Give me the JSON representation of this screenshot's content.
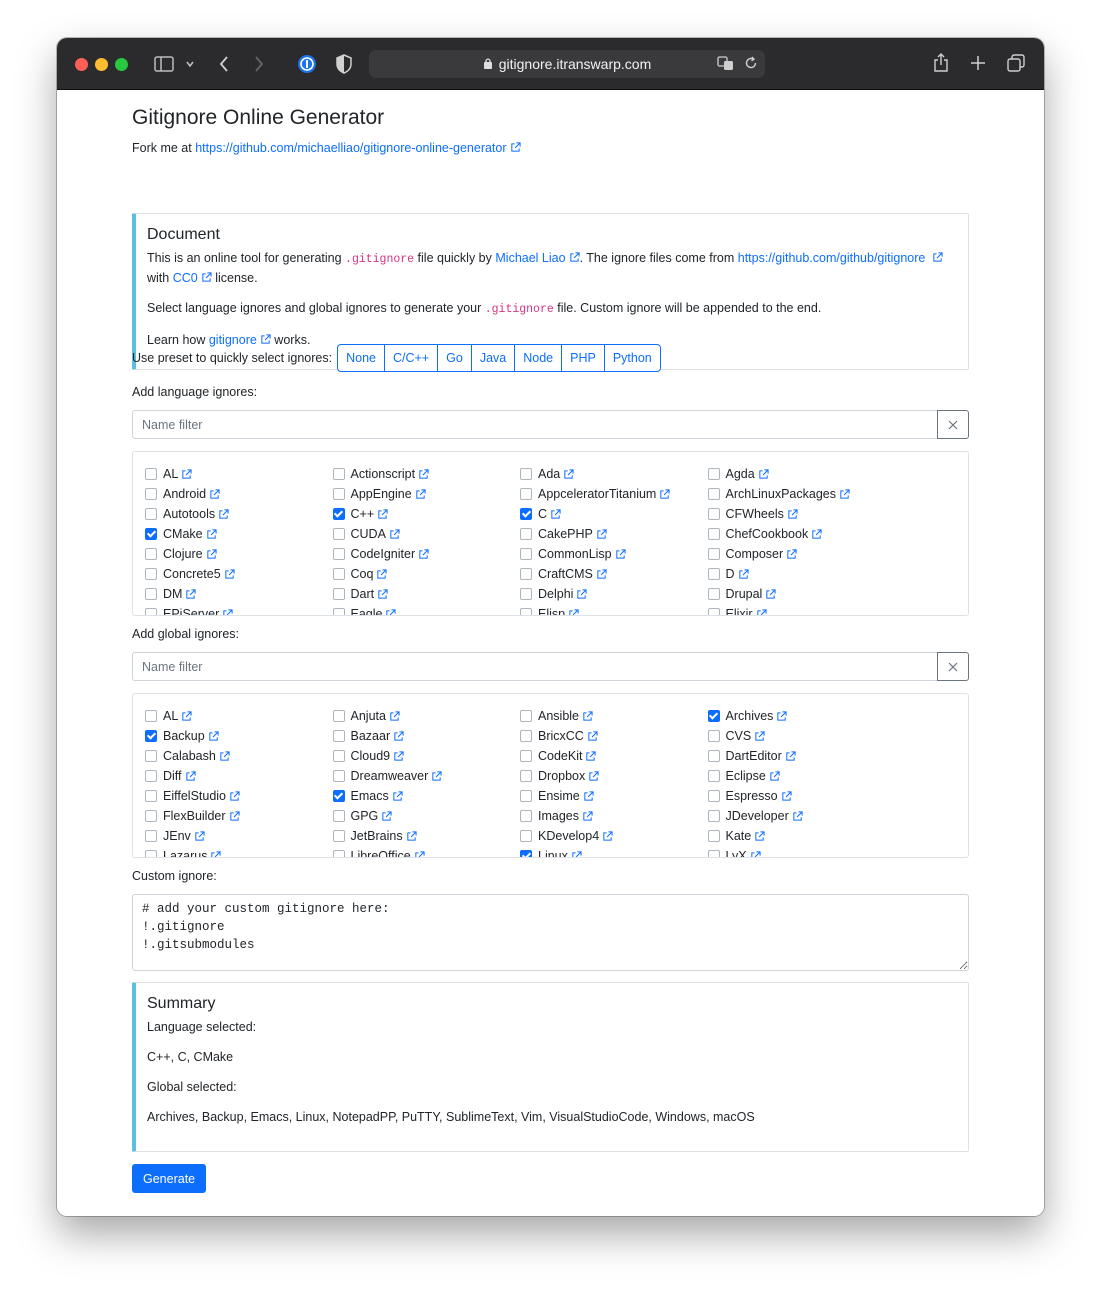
{
  "browser": {
    "url": "gitignore.itranswarp.com"
  },
  "page": {
    "title": "Gitignore Online Generator",
    "fork_prefix": "Fork me at",
    "fork_link": "https://github.com/michaelliao/gitignore-online-generator"
  },
  "document": {
    "heading": "Document",
    "p1_a": "This is an online tool for generating",
    "p1_code": ".gitignore",
    "p1_b": "file quickly by",
    "p1_author": "Michael Liao",
    "p1_c": ". The ignore files come from",
    "p1_source": "https://github.com/github/gitignore",
    "p1_d": "with",
    "p1_license": "CC0",
    "p1_e": "license.",
    "p2_a": "Select language ignores and global ignores to generate your",
    "p2_code": ".gitignore",
    "p2_b": "file. Custom ignore will be appended to the end.",
    "p3_a": "Learn how",
    "p3_link": "gitignore",
    "p3_b": "works."
  },
  "preset": {
    "label": "Use preset to quickly select ignores:",
    "buttons": [
      "None",
      "C/C++",
      "Go",
      "Java",
      "Node",
      "PHP",
      "Python"
    ]
  },
  "language": {
    "label": "Add language ignores:",
    "filter_placeholder": "Name filter",
    "items": [
      {
        "name": "AL",
        "checked": false
      },
      {
        "name": "Actionscript",
        "checked": false
      },
      {
        "name": "Ada",
        "checked": false
      },
      {
        "name": "Agda",
        "checked": false
      },
      {
        "name": "Android",
        "checked": false
      },
      {
        "name": "AppEngine",
        "checked": false
      },
      {
        "name": "AppceleratorTitanium",
        "checked": false
      },
      {
        "name": "ArchLinuxPackages",
        "checked": false
      },
      {
        "name": "Autotools",
        "checked": false
      },
      {
        "name": "C++",
        "checked": true
      },
      {
        "name": "C",
        "checked": true
      },
      {
        "name": "CFWheels",
        "checked": false
      },
      {
        "name": "CMake",
        "checked": true
      },
      {
        "name": "CUDA",
        "checked": false
      },
      {
        "name": "CakePHP",
        "checked": false
      },
      {
        "name": "ChefCookbook",
        "checked": false
      },
      {
        "name": "Clojure",
        "checked": false
      },
      {
        "name": "CodeIgniter",
        "checked": false
      },
      {
        "name": "CommonLisp",
        "checked": false
      },
      {
        "name": "Composer",
        "checked": false
      },
      {
        "name": "Concrete5",
        "checked": false
      },
      {
        "name": "Coq",
        "checked": false
      },
      {
        "name": "CraftCMS",
        "checked": false
      },
      {
        "name": "D",
        "checked": false
      },
      {
        "name": "DM",
        "checked": false
      },
      {
        "name": "Dart",
        "checked": false
      },
      {
        "name": "Delphi",
        "checked": false
      },
      {
        "name": "Drupal",
        "checked": false
      },
      {
        "name": "EPiServer",
        "checked": false
      },
      {
        "name": "Eagle",
        "checked": false
      },
      {
        "name": "Elisp",
        "checked": false
      },
      {
        "name": "Elixir",
        "checked": false
      }
    ]
  },
  "global": {
    "label": "Add global ignores:",
    "filter_placeholder": "Name filter",
    "items": [
      {
        "name": "AL",
        "checked": false
      },
      {
        "name": "Anjuta",
        "checked": false
      },
      {
        "name": "Ansible",
        "checked": false
      },
      {
        "name": "Archives",
        "checked": true
      },
      {
        "name": "Backup",
        "checked": true
      },
      {
        "name": "Bazaar",
        "checked": false
      },
      {
        "name": "BricxCC",
        "checked": false
      },
      {
        "name": "CVS",
        "checked": false
      },
      {
        "name": "Calabash",
        "checked": false
      },
      {
        "name": "Cloud9",
        "checked": false
      },
      {
        "name": "CodeKit",
        "checked": false
      },
      {
        "name": "DartEditor",
        "checked": false
      },
      {
        "name": "Diff",
        "checked": false
      },
      {
        "name": "Dreamweaver",
        "checked": false
      },
      {
        "name": "Dropbox",
        "checked": false
      },
      {
        "name": "Eclipse",
        "checked": false
      },
      {
        "name": "EiffelStudio",
        "checked": false
      },
      {
        "name": "Emacs",
        "checked": true
      },
      {
        "name": "Ensime",
        "checked": false
      },
      {
        "name": "Espresso",
        "checked": false
      },
      {
        "name": "FlexBuilder",
        "checked": false
      },
      {
        "name": "GPG",
        "checked": false
      },
      {
        "name": "Images",
        "checked": false
      },
      {
        "name": "JDeveloper",
        "checked": false
      },
      {
        "name": "JEnv",
        "checked": false
      },
      {
        "name": "JetBrains",
        "checked": false
      },
      {
        "name": "KDevelop4",
        "checked": false
      },
      {
        "name": "Kate",
        "checked": false
      },
      {
        "name": "Lazarus",
        "checked": false
      },
      {
        "name": "LibreOffice",
        "checked": false
      },
      {
        "name": "Linux",
        "checked": true
      },
      {
        "name": "LyX",
        "checked": false
      }
    ]
  },
  "custom": {
    "label": "Custom ignore:",
    "value": "# add your custom gitignore here:\n!.gitignore\n!.gitsubmodules"
  },
  "summary": {
    "heading": "Summary",
    "language_label": "Language selected:",
    "language_value": "C++, C, CMake",
    "global_label": "Global selected:",
    "global_value": "Archives, Backup, Emacs, Linux, NotepadPP, PuTTY, SublimeText, Vim, VisualStudioCode, Windows, macOS"
  },
  "generate_label": "Generate",
  "colors": {
    "primary": "#0d6efd",
    "callout_border": "#5bc0de",
    "code": "#d63384"
  }
}
